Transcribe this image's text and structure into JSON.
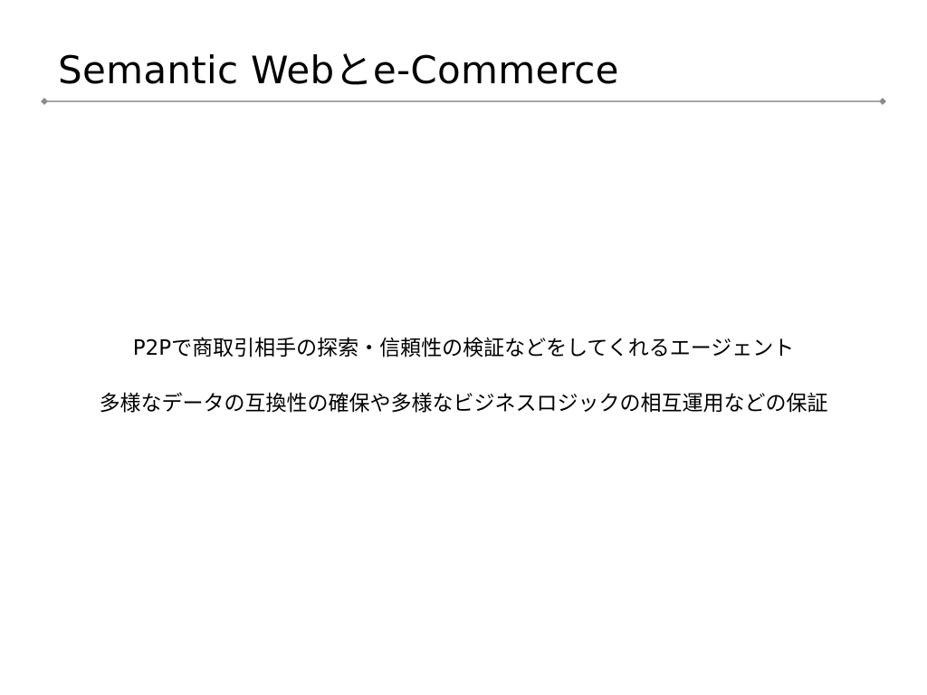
{
  "slide": {
    "title": "Semantic Webとe-Commerce",
    "rule_color": "#8a8a8a",
    "body": [
      "P2Pで商取引相手の探索・信頼性の検証などをしてくれるエージェント",
      "多様なデータの互換性の確保や多様なビジネスロジックの相互運用などの保証"
    ]
  }
}
